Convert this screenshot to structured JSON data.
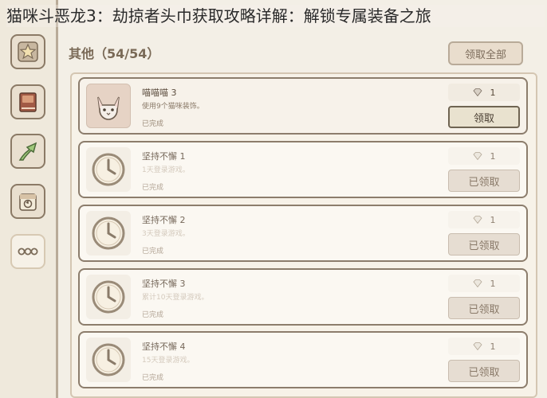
{
  "overlay_title": "猫咪斗恶龙3：劫掠者头巾获取攻略详解：解锁专属装备之旅",
  "header": {
    "section_title": "其他（54/54）",
    "claim_all_label": "领取全部"
  },
  "sidebar": {
    "items": [
      {
        "icon": "star-icon"
      },
      {
        "icon": "book-icon"
      },
      {
        "icon": "arrow-up-icon"
      },
      {
        "icon": "calendar-icon"
      },
      {
        "icon": "more-icon",
        "label": "ooo",
        "active": true
      }
    ]
  },
  "achievements": [
    {
      "title": "喵喵喵 3",
      "desc": "使用9个猫咪装饰。",
      "status": "已完成",
      "reward": "1",
      "button": "领取",
      "claimed": false,
      "icon": "cat-icon"
    },
    {
      "title": "坚持不懈 1",
      "desc": "1天登录游戏。",
      "status": "已完成",
      "reward": "1",
      "button": "已领取",
      "claimed": true,
      "icon": "clock-icon"
    },
    {
      "title": "坚持不懈 2",
      "desc": "3天登录游戏。",
      "status": "已完成",
      "reward": "1",
      "button": "已领取",
      "claimed": true,
      "icon": "clock-icon"
    },
    {
      "title": "坚持不懈 3",
      "desc": "累计10天登录游戏。",
      "status": "已完成",
      "reward": "1",
      "button": "已领取",
      "claimed": true,
      "icon": "clock-icon"
    },
    {
      "title": "坚持不懈 4",
      "desc": "15天登录游戏。",
      "status": "已完成",
      "reward": "1",
      "button": "已领取",
      "claimed": true,
      "icon": "clock-icon"
    }
  ]
}
